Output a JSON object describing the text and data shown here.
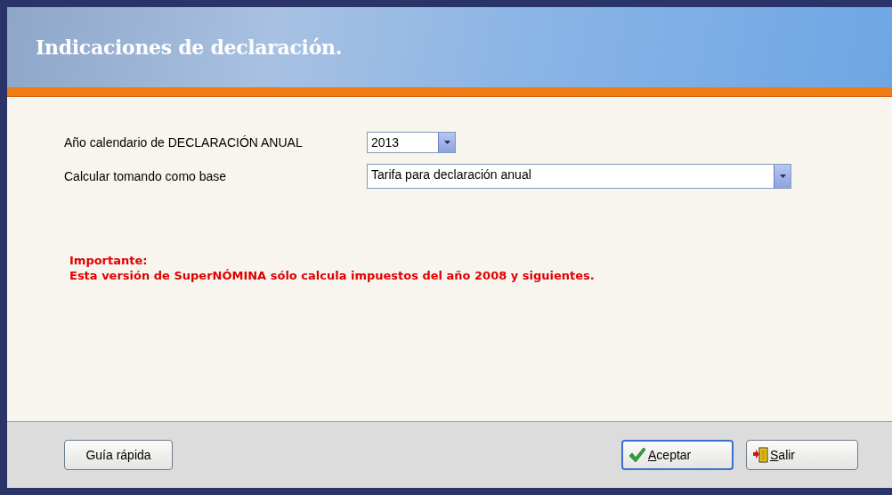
{
  "window": {
    "title": "Indicaciones de declaración."
  },
  "fields": [
    {
      "label": "Año calendario de DECLARACIÓN ANUAL",
      "value": "2013",
      "kind": "short"
    },
    {
      "label": "Calcular tomando como base",
      "value": "Tarifa para declaración anual",
      "kind": "wide"
    }
  ],
  "notice": {
    "heading": "Importante:",
    "text": "Esta versión de SuperNÓMINA sólo calcula impuestos del año 2008 y siguientes."
  },
  "buttons": [
    {
      "label": "Guía rápida",
      "kind": "help",
      "focused": false
    },
    {
      "label": "Aceptar",
      "kind": "accept",
      "focused": true
    },
    {
      "label": "Salir",
      "kind": "exit",
      "focused": false
    }
  ]
}
